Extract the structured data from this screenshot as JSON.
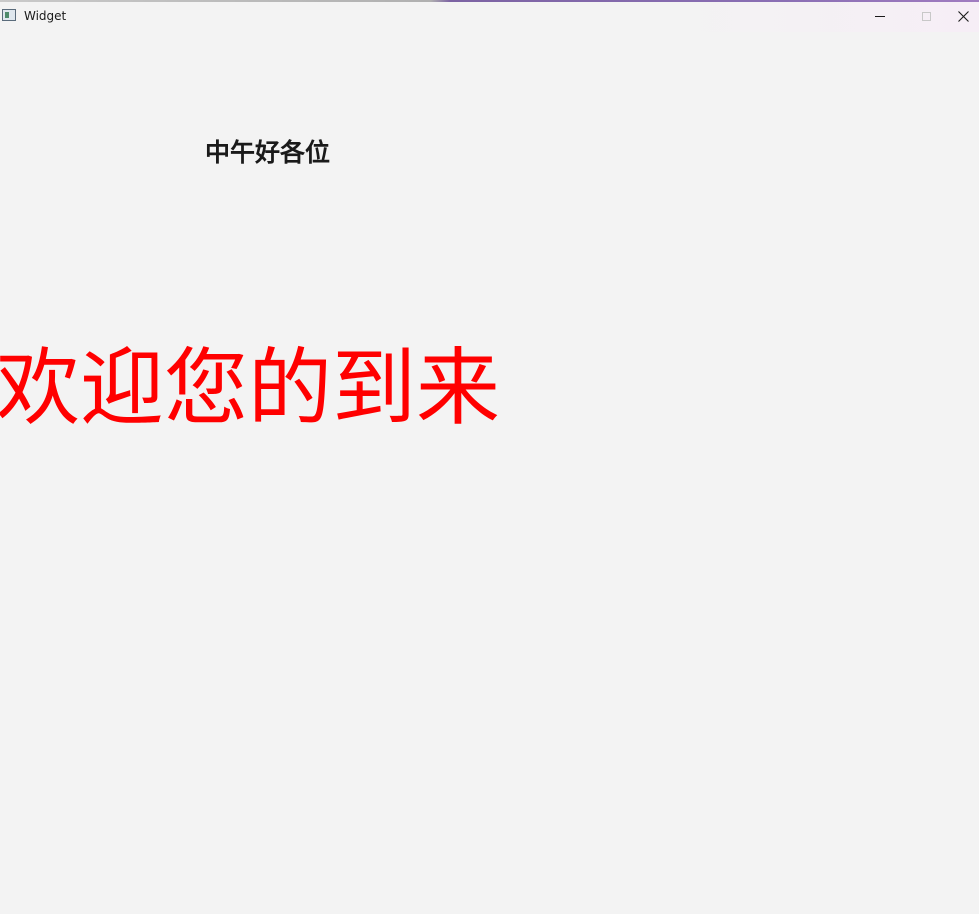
{
  "window": {
    "title": "Widget",
    "icon": "app-window-icon",
    "controls": {
      "minimize_icon": "minimize-icon",
      "maximize_icon": "maximize-icon",
      "close_icon": "close-icon"
    }
  },
  "content": {
    "greeting": "中午好各位",
    "welcome": "欢迎您的到来",
    "welcome_color": "#ff0000",
    "greeting_color": "#1a1a1a",
    "background_color": "#f3f3f3"
  }
}
